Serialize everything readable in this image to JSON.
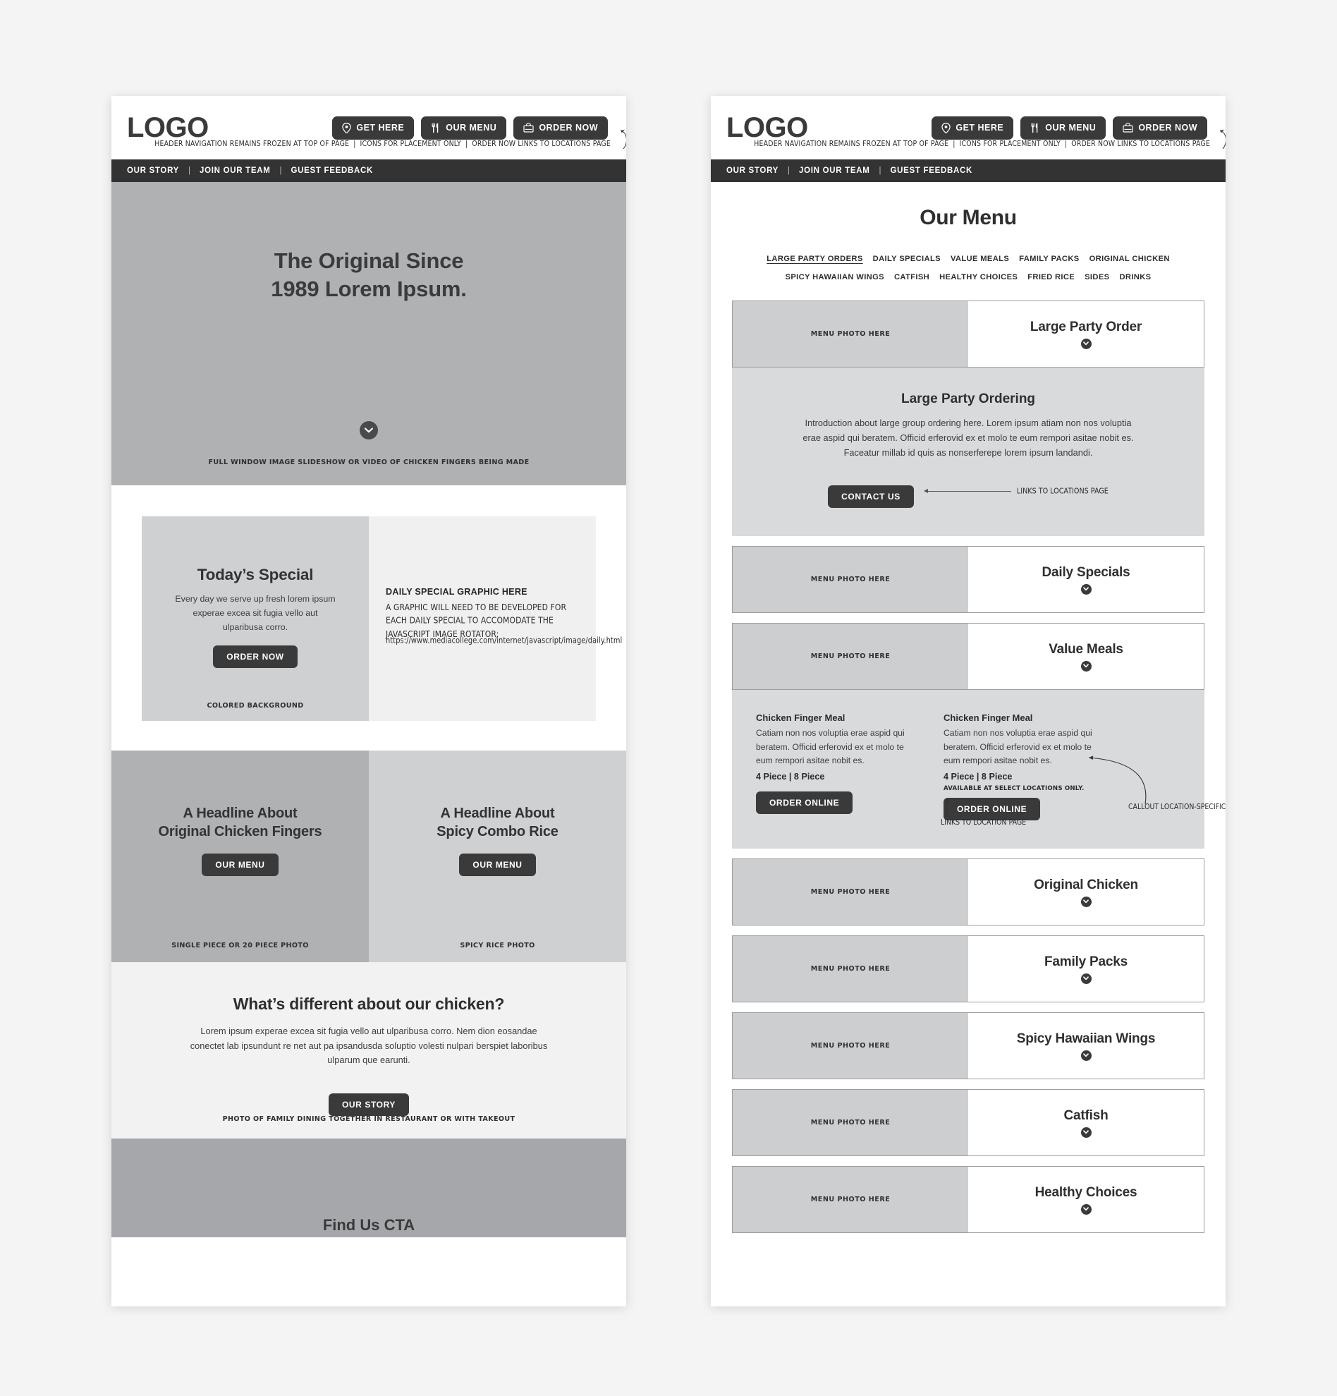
{
  "header": {
    "logo": "LOGO",
    "buttons": [
      {
        "label": "GET HERE",
        "icon": "location-pin-icon"
      },
      {
        "label": "OUR MENU",
        "icon": "fork-knife-icon"
      },
      {
        "label": "ORDER NOW",
        "icon": "shopping-bag-icon"
      }
    ],
    "annotations": [
      "HEADER NAVIGATION REMAINS FROZEN AT TOP OF PAGE",
      "ICONS FOR PLACEMENT ONLY",
      "ORDER NOW LINKS TO LOCATIONS PAGE"
    ],
    "separator": "|"
  },
  "nav": {
    "items": [
      "OUR STORY",
      "JOIN OUR TEAM",
      "GUEST FEEDBACK"
    ],
    "separator": "|"
  },
  "home": {
    "hero": {
      "headline_line1": "The Original Since",
      "headline_line2": "1989 Lorem Ipsum.",
      "scroll_icon": "chevron-down-circle-icon",
      "caption": "FULL WINDOW IMAGE SLIDESHOW OR VIDEO OF CHICKEN FINGERS BEING MADE"
    },
    "special": {
      "title": "Today’s Special",
      "body": "Every day we serve up fresh lorem ipsum experae excea sit fugia vello aut ulparibusa corro.",
      "cta": "ORDER NOW",
      "caption": "COLORED BACKGROUND",
      "graphic_title": "DAILY SPECIAL GRAPHIC HERE",
      "graphic_note": "A GRAPHIC WILL NEED TO BE DEVELOPED FOR EACH DAILY SPECIAL TO ACCOMODATE THE JAVASCRIPT IMAGE ROTATOR:",
      "graphic_url": "https://www.mediacollege.com/internet/javascript/image/daily.html"
    },
    "columns": [
      {
        "headline_line1": "A Headline About",
        "headline_line2": "Original Chicken Fingers",
        "cta": "OUR MENU",
        "caption": "SINGLE PIECE OR 20 PIECE PHOTO"
      },
      {
        "headline_line1": "A Headline About",
        "headline_line2": "Spicy Combo Rice",
        "cta": "OUR MENU",
        "caption": "SPICY RICE PHOTO"
      }
    ],
    "different": {
      "title": "What’s different about our chicken?",
      "body": "Lorem ipsum experae excea sit fugia vello aut ulparibusa corro. Nem dion eosandae conectet lab ipsundunt re net aut pa ipsandusda soluptio volesti nulpari berspiet laboribus ulparum que earunti.",
      "cta": "OUR STORY",
      "caption": "PHOTO OF FAMILY DINING TOGETHER IN RESTAURANT OR WITH TAKEOUT"
    },
    "findus": {
      "title": "Find Us CTA"
    }
  },
  "menu": {
    "title": "Our Menu",
    "categories": [
      {
        "label": "LARGE PARTY ORDERS",
        "active": true
      },
      {
        "label": "DAILY SPECIALS",
        "active": false
      },
      {
        "label": "VALUE MEALS",
        "active": false
      },
      {
        "label": "FAMILY PACKS",
        "active": false
      },
      {
        "label": "ORIGINAL CHICKEN",
        "active": false
      },
      {
        "label": "SPICY HAWAIIAN WINGS",
        "active": false
      },
      {
        "label": "CATFISH",
        "active": false
      },
      {
        "label": "HEALTHY CHOICES",
        "active": false
      },
      {
        "label": "FRIED RICE",
        "active": false
      },
      {
        "label": "SIDES",
        "active": false
      },
      {
        "label": "DRINKS",
        "active": false
      }
    ],
    "photo_placeholder": "MENU PHOTO HERE",
    "rows": [
      {
        "label": "Large Party Order"
      },
      {
        "label": "Daily Specials"
      },
      {
        "label": "Value Meals"
      },
      {
        "label": "Original Chicken"
      },
      {
        "label": "Family Packs"
      },
      {
        "label": "Spicy Hawaiian Wings"
      },
      {
        "label": "Catfish"
      },
      {
        "label": "Healthy Choices"
      }
    ],
    "large_party_panel": {
      "title": "Large Party Ordering",
      "body": "Introduction about large group ordering here. Lorem ipsum atiam non nos voluptia erae aspid qui beratem. Officid erferovid ex et molo te eum rempori asitae nobit es. Faceatur millab id quis as nonserferepe lorem ipsum landandi.",
      "cta": "CONTACT US",
      "annotation": "LINKS TO LOCATIONS PAGE"
    },
    "value_meals_panel": {
      "meals": [
        {
          "name": "Chicken Finger Meal",
          "desc": "Catiam non nos voluptia erae aspid qui beratem. Officid erferovid ex et molo te eum rempori asitae nobit es.",
          "pieces": "4 Piece | 8 Piece",
          "cta": "ORDER ONLINE"
        },
        {
          "name": "Chicken Finger Meal",
          "desc": "Catiam non nos voluptia erae aspid qui beratem. Officid erferovid ex et molo te eum rempori asitae nobit es.",
          "pieces": "4 Piece | 8 Piece",
          "cta": "ORDER ONLINE",
          "availability_note": "AVAILABLE AT SELECT LOCATIONS ONLY."
        }
      ],
      "annotation_link": "LINKS TO LOCATION PAGE",
      "annotation_callout": "CALLOUT LOCATION-SPECIFIC ITEMS."
    }
  }
}
